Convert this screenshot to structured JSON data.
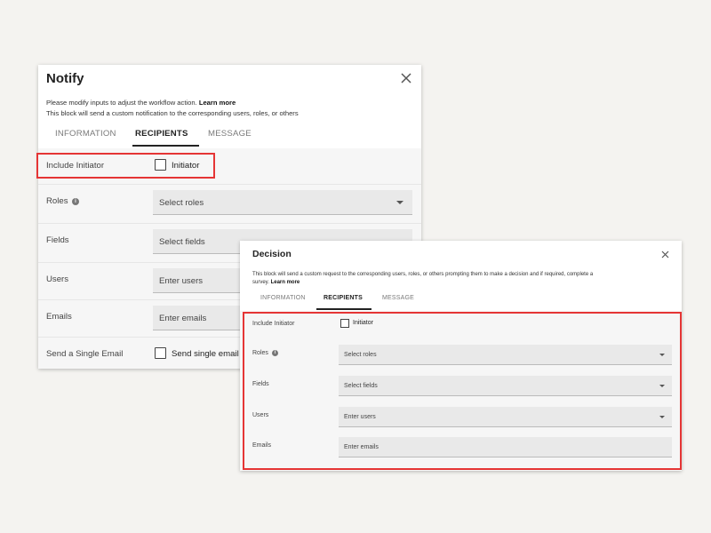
{
  "notify": {
    "title": "Notify",
    "description_line1": "Please modify inputs to adjust the workflow action.",
    "learn_more": "Learn more",
    "description_line2": "This block will send a custom notification to the corresponding users, roles, or others",
    "tabs": [
      "INFORMATION",
      "RECIPIENTS",
      "MESSAGE"
    ],
    "active_tab": "RECIPIENTS",
    "rows": {
      "include_initiator": {
        "label": "Include Initiator",
        "checkbox_label": "Initiator",
        "checked": false
      },
      "roles": {
        "label": "Roles",
        "placeholder": "Select roles"
      },
      "fields": {
        "label": "Fields",
        "placeholder": "Select fields"
      },
      "users": {
        "label": "Users",
        "placeholder": "Enter users"
      },
      "emails": {
        "label": "Emails",
        "placeholder": "Enter emails"
      },
      "single_email": {
        "label": "Send a Single Email",
        "checkbox_label": "Send single email",
        "checked": false
      }
    }
  },
  "decision": {
    "title": "Decision",
    "description_line1": "This block will send a custom request to the corresponding users, roles, or others prompting them to make a decision and if required, complete a",
    "description_line2": "survey.",
    "learn_more": "Learn more",
    "tabs": [
      "INFORMATION",
      "RECIPIENTS",
      "MESSAGE"
    ],
    "active_tab": "RECIPIENTS",
    "rows": {
      "include_initiator": {
        "label": "Include Initiator",
        "checkbox_label": "Initiator",
        "checked": false
      },
      "roles": {
        "label": "Roles",
        "placeholder": "Select roles"
      },
      "fields": {
        "label": "Fields",
        "placeholder": "Select fields"
      },
      "users": {
        "label": "Users",
        "placeholder": "Enter users"
      },
      "emails": {
        "label": "Emails",
        "placeholder": "Enter emails"
      }
    }
  },
  "icons": {
    "close": "close-icon",
    "info": "info-icon",
    "dropdown": "chevron-down-icon"
  },
  "colors": {
    "background": "#f4f3f0",
    "highlight": "#e53535",
    "form_background": "#f6f6f6",
    "field_background": "#e9e9e9"
  }
}
